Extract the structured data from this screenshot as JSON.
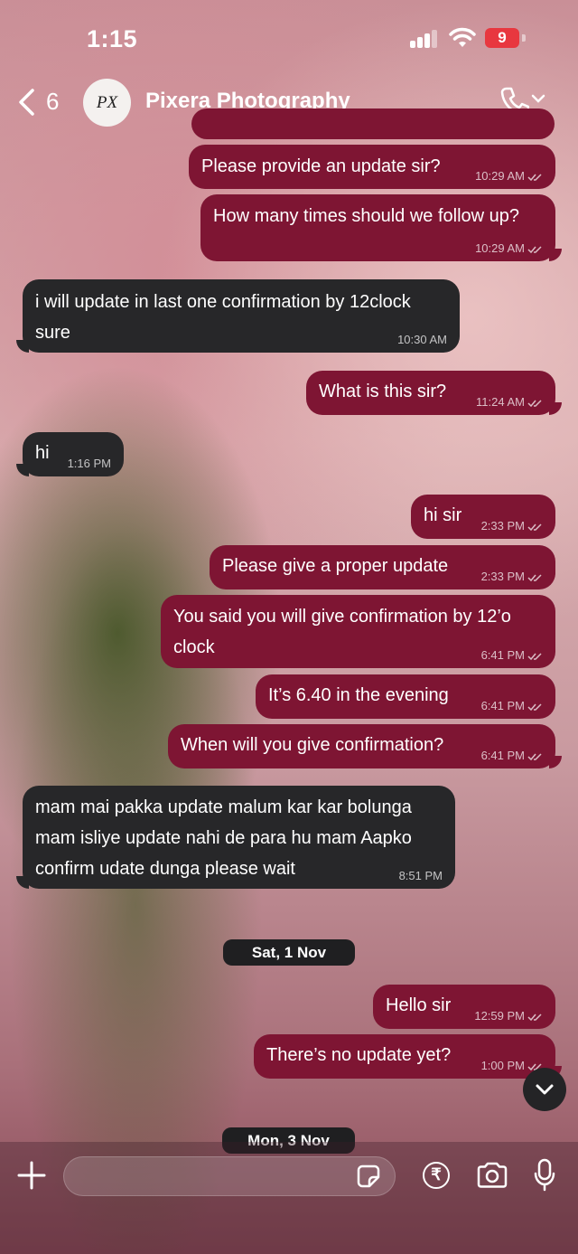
{
  "status": {
    "time": "1:15",
    "battery": "9"
  },
  "header": {
    "back_count": "6",
    "avatar_initials": "PX",
    "contact_name": "Pixera Photography"
  },
  "messages": [
    {
      "dir": "out",
      "text": "Please provide an update sir?",
      "time": "10:29 AM"
    },
    {
      "dir": "out",
      "text": "How many times should we follow up?",
      "time": "10:29 AM"
    },
    {
      "dir": "in",
      "text": "i will update in last one confirmation by 12clock sure",
      "time": "10:30 AM"
    },
    {
      "dir": "out",
      "text": "What is this sir?",
      "time": "11:24 AM"
    },
    {
      "dir": "in",
      "text": "hi",
      "time": "1:16 PM"
    },
    {
      "dir": "out",
      "text": "hi sir",
      "time": "2:33 PM"
    },
    {
      "dir": "out",
      "text": "Please give a proper update",
      "time": "2:33 PM"
    },
    {
      "dir": "out",
      "text": "You said you will give confirmation by 12’o clock",
      "time": "6:41 PM"
    },
    {
      "dir": "out",
      "text": "It’s 6.40 in the evening",
      "time": "6:41 PM"
    },
    {
      "dir": "out",
      "text": "When will you give confirmation?",
      "time": "6:41 PM"
    },
    {
      "dir": "in",
      "text": "mam mai pakka update malum kar kar bolunga mam isliye update nahi de para hu mam Aapko confirm udate dunga please wait",
      "time": "8:51 PM"
    },
    {
      "dir": "out",
      "text": "Hello sir",
      "time": "12:59 PM"
    },
    {
      "dir": "out",
      "text": "There’s no update yet?",
      "time": "1:00 PM"
    }
  ],
  "date_separators": [
    "Sat, 1 Nov",
    "Mon, 3 Nov"
  ],
  "input": {
    "placeholder": ""
  },
  "icons": [
    "chevron-left-icon",
    "phone-icon",
    "chevron-down-icon",
    "plus-icon",
    "sticker-icon",
    "rupee-icon",
    "camera-icon",
    "mic-icon"
  ],
  "colors": {
    "outgoing_bubble": "#7e1533",
    "incoming_bubble": "#272729",
    "battery": "#e8373f"
  }
}
